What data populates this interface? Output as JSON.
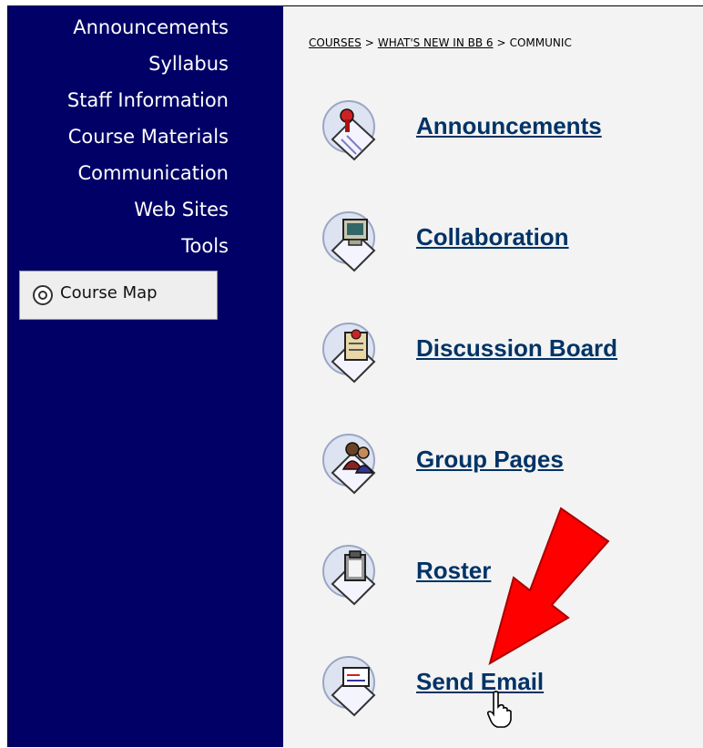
{
  "sidebar": {
    "items": [
      {
        "label": "Announcements"
      },
      {
        "label": "Syllabus"
      },
      {
        "label": "Staff Information"
      },
      {
        "label": "Course Materials"
      },
      {
        "label": "Communication"
      },
      {
        "label": "Web Sites"
      },
      {
        "label": "Tools"
      }
    ],
    "course_map": {
      "label": "Course Map",
      "icon": "course-map-icon"
    },
    "background_color": "#000066"
  },
  "breadcrumb": {
    "items": [
      "COURSES",
      "WHAT'S NEW IN BB 6",
      "COMMUNIC"
    ],
    "separator": ">"
  },
  "main": {
    "tools": [
      {
        "label": "Announcements",
        "icon": "announcements-icon"
      },
      {
        "label": "Collaboration",
        "icon": "collaboration-icon"
      },
      {
        "label": "Discussion Board",
        "icon": "discussion-board-icon"
      },
      {
        "label": "Group Pages",
        "icon": "group-pages-icon"
      },
      {
        "label": "Roster",
        "icon": "roster-icon"
      },
      {
        "label": "Send Email",
        "icon": "send-email-icon"
      }
    ],
    "link_color": "#003366"
  },
  "annotation": {
    "arrow_color": "#ff0000",
    "pointer": "hand-cursor-icon"
  }
}
